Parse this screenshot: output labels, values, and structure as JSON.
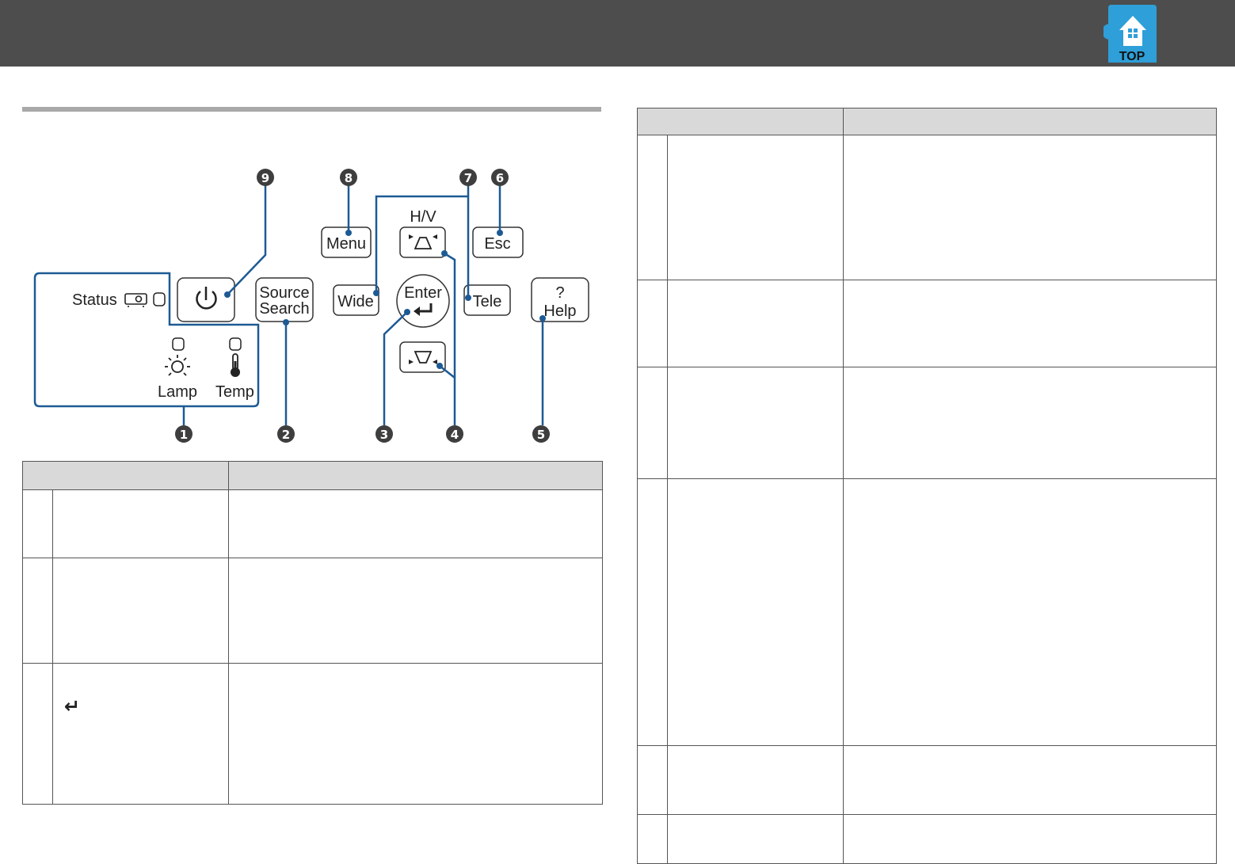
{
  "top_button": {
    "label": "TOP",
    "icon": "building-icon",
    "color": "#2e9fd8"
  },
  "diagram": {
    "status_label": "Status",
    "lamp_label": "Lamp",
    "temp_label": "Temp",
    "source_line1": "Source",
    "source_line2": "Search",
    "menu_label": "Menu",
    "esc_label": "Esc",
    "hv_label": "H/V",
    "wide_label": "Wide",
    "enter_label": "Enter",
    "tele_label": "Tele",
    "help_symbol": "?",
    "help_label": "Help",
    "callouts": [
      "1",
      "2",
      "3",
      "4",
      "5",
      "6",
      "7",
      "8",
      "9"
    ],
    "accent_color": "#1d5a94"
  },
  "left_table": {
    "enter_symbol": "↵"
  }
}
